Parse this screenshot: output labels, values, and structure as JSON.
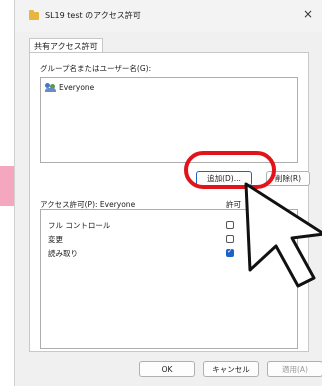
{
  "window": {
    "title": "SL19 test のアクセス許可",
    "close_glyph": "×"
  },
  "tabs": [
    {
      "label": "共有アクセス許可"
    }
  ],
  "group_section": {
    "label": "グループ名またはユーザー名(G):",
    "users": [
      {
        "name": "Everyone"
      }
    ],
    "add_button": "追加(D)...",
    "remove_button": "削除(R)"
  },
  "permissions": {
    "label": "アクセス許可(P): Everyone",
    "allow_header": "許可",
    "rows": [
      {
        "name": "フル コントロール",
        "allow": false
      },
      {
        "name": "変更",
        "allow": false
      },
      {
        "name": "読み取り",
        "allow": true
      }
    ]
  },
  "footer": {
    "ok": "OK",
    "cancel": "キャンセル",
    "apply": "適用(A)"
  },
  "colors": {
    "highlight_ring": "#e0141a",
    "accent": "#1e62c8",
    "pink_strip": "#f4a7bf"
  }
}
